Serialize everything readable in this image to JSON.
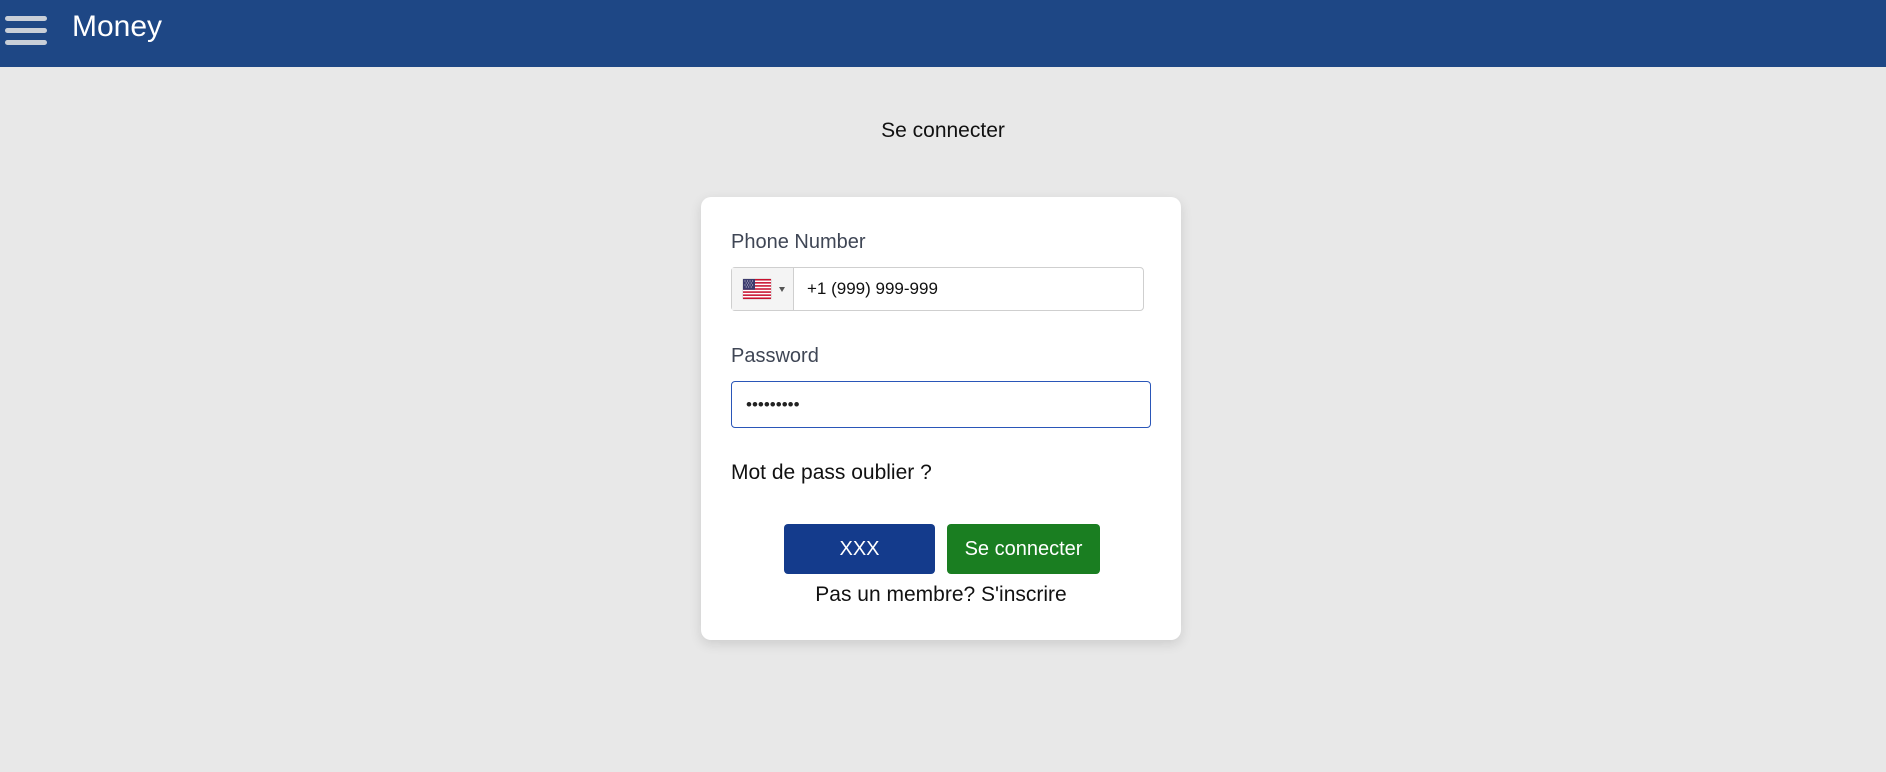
{
  "header": {
    "title": "Money",
    "background": "#1e4785"
  },
  "page": {
    "heading": "Se connecter"
  },
  "form": {
    "phone_label": "Phone Number",
    "phone_value": "+1 (999) 999-999",
    "country_flag": "us-flag-icon",
    "password_label": "Password",
    "password_value": "•••••••••",
    "forgot_link": "Mot de pass oublier ?",
    "secondary_button": "XXX",
    "submit_button": "Se connecter",
    "signup_link": "Pas un membre? S'inscrire"
  },
  "colors": {
    "primary": "#143b8c",
    "success": "#1a7e21",
    "focus_border": "#2a56b8"
  }
}
